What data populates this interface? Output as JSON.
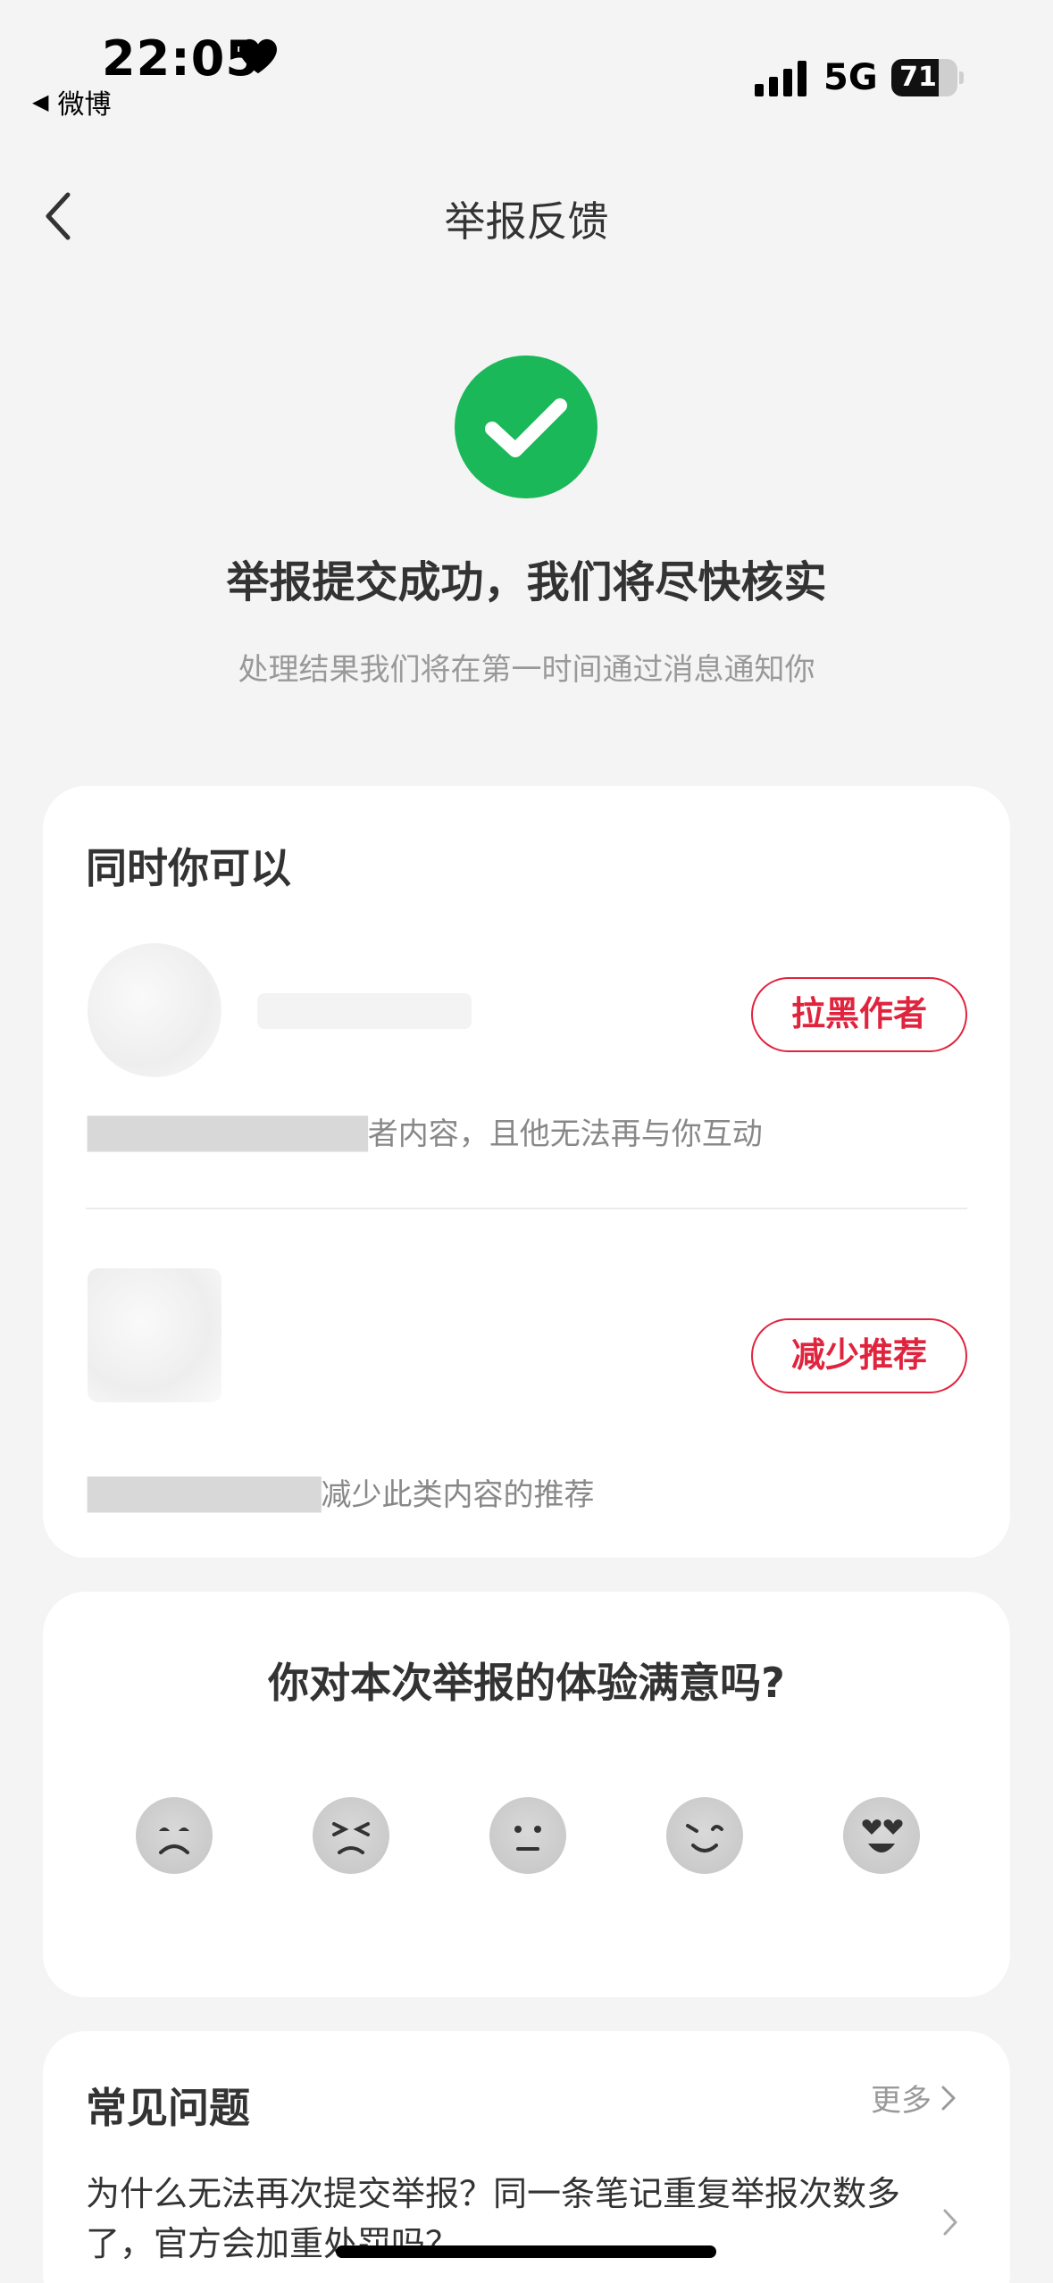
{
  "status_bar": {
    "time": "22:05",
    "back_app": "微博",
    "network": "5G",
    "battery": "71",
    "battery_level": 0.71,
    "icons": [
      "heart-icon",
      "signal-icon",
      "battery-icon"
    ]
  },
  "nav": {
    "title": "举报反馈",
    "back_icon": "chevron-left-icon"
  },
  "success": {
    "icon": "check-circle-icon",
    "icon_color": "#1bb85a",
    "title": "举报提交成功，我们将尽快核实",
    "subtitle": "处理结果我们将在第一时间通过消息通知你"
  },
  "also": {
    "heading": "同时你可以",
    "items": [
      {
        "button": "拉黑作者",
        "desc_visible": "者内容，且他无法再与你互动"
      },
      {
        "button": "减少推荐",
        "desc_visible": "减少此类内容的推荐"
      }
    ],
    "accent_color": "#e0243e"
  },
  "rating": {
    "title": "你对本次举报的体验满意吗?",
    "emojis": [
      "very-dissatisfied-emoji-icon",
      "dissatisfied-emoji-icon",
      "neutral-emoji-icon",
      "satisfied-emoji-icon",
      "very-satisfied-emoji-icon"
    ]
  },
  "faq": {
    "heading": "常见问题",
    "more": "更多",
    "question": "为什么无法再次提交举报？同一条笔记重复举报次数多了，官方会加重处罚吗？"
  }
}
